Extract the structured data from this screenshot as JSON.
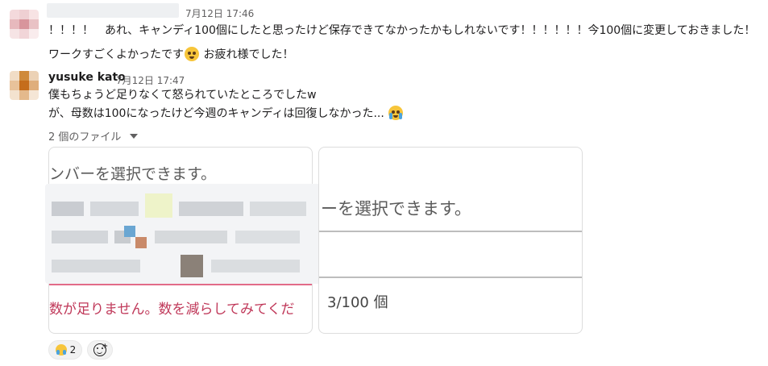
{
  "messages": [
    {
      "author": "",
      "timestamp": "7月12日 17:46",
      "lines": [
        "！！！！　あれ、キャンディ100個にしたと思ったけど保存できてなかったかもしれないです！！！！！！今100個に変更しておきました！",
        "ワークすごくよかったです",
        "お疲れ様でした！"
      ]
    },
    {
      "author": "yusuke kato",
      "timestamp": "7月12日 17:47",
      "lines": [
        "僕もちょうど足りなくて怒られていたところでしたw",
        "が、母数は100になったけど今週のキャンディは回復しなかった..."
      ]
    }
  ],
  "files": {
    "toggle_label": "2 個のファイル",
    "card1": {
      "top_text": "ンバーを選択できます。",
      "error_text": "数が足りません。数を減らしてみてくだ"
    },
    "card2": {
      "top_text": "ーを選択できます。",
      "count_text": "3/100 個"
    }
  },
  "reactions": [
    {
      "emoji": "crying-face",
      "count": "2"
    }
  ],
  "icons": {
    "add_reaction": "add-reaction-icon",
    "files_chevron": "chevron-down-icon"
  },
  "colors": {
    "error_text": "#c0395a",
    "error_line": "#e26b88",
    "timestamp": "#616061"
  }
}
